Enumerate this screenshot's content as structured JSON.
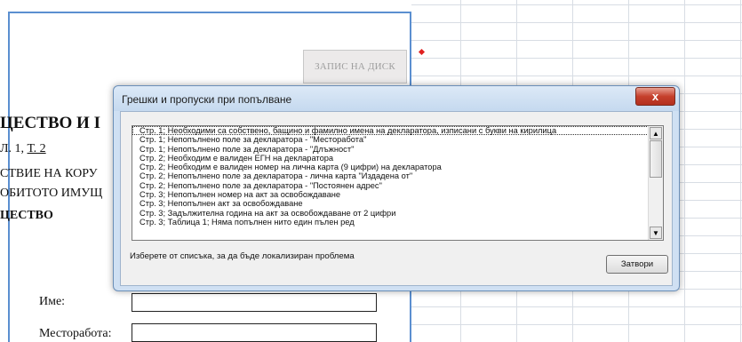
{
  "sheet": {
    "save_button": "ЗАПИС НА ДИСК",
    "title_fragment": "ЦЕСТВО И І",
    "line1_prefix": "Л. 1, ",
    "line1_link": "Т. 2",
    "line2": "СТВИЕ НА КОРУ",
    "line3": "ОБИТОТО ИМУЩ",
    "line4": "ЦЕСТВО",
    "field_name_label": "Име:",
    "field_workplace_label": "Месторабота:"
  },
  "dialog": {
    "title": "Грешки и пропуски при попълване",
    "close_glyph": "x",
    "errors": [
      "Стр. 1; Необходими са собствено, бащино и фамилно имена на декларатора, изписани с букви на кирилица",
      "Стр. 1; Непопълнено поле за декларатора - \"Месторабота\"",
      "Стр. 1; Непопълнено поле за декларатора - \"Длъжност\"",
      "Стр. 2; Необходим е валиден ЕГН на декларатора",
      "Стр. 2; Необходим е валиден номер на лична карта (9 цифри) на декларатора",
      "Стр. 2; Непопълнено поле за декларатора - лична карта \"Издадена от\"",
      "Стр. 2; Непопълнено поле за декларатора - \"Постоянен адрес\"",
      "Стр. 3; Непопълнен номер на акт за освобождаване",
      "Стр. 3; Непопълнен акт за освобождаване",
      "Стр. 3; Задължителна година на акт за освобождаване от 2 цифри",
      "Стр. 3; Таблица 1; Няма попълнен нито един пълен ред"
    ],
    "hint": "Изберете от списъка, за да бъде локализиран проблема",
    "close_button": "Затвори",
    "scroll_up": "▲",
    "scroll_down": "▼"
  }
}
